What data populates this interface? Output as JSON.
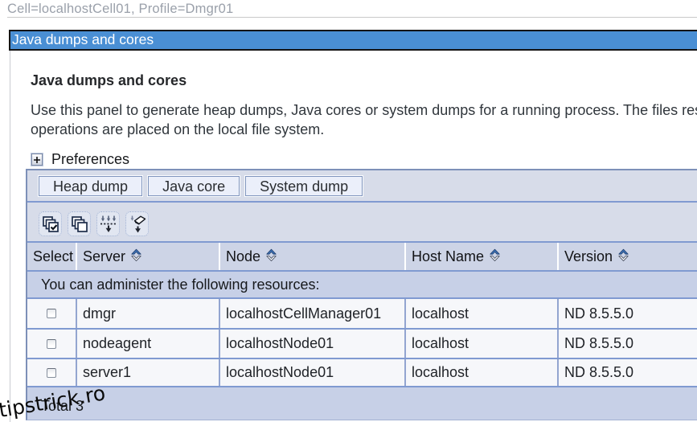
{
  "theme": {
    "title_bar_blue": "#4a8fd4",
    "toolbar_bg": "#d7dce9",
    "header_bg": "#cdd4e6",
    "band_bg": "#c7d0e7",
    "row_bg": "#f6f7fa",
    "grid_blue": "#809ad1",
    "breadcrumb_gray": "#9aa0aa"
  },
  "breadcrumb": {
    "text": "Cell=localhostCell01, Profile=Dmgr01"
  },
  "title_bar": {
    "title": "Java dumps and cores"
  },
  "content": {
    "heading": "Java dumps and cores",
    "description_line1": "Use this panel to generate heap dumps, Java cores or system dumps for a running process. The files res",
    "description_line2": "operations are placed on the local file system.",
    "preferences_label": "Preferences",
    "preferences_icon": "plus-expand-icon"
  },
  "table": {
    "buttons": [
      {
        "label": "Heap dump"
      },
      {
        "label": "Java core"
      },
      {
        "label": "System dump"
      }
    ],
    "icon_buttons": [
      {
        "name": "select-all-items-icon"
      },
      {
        "name": "deselect-all-items-icon"
      },
      {
        "name": "show-filter-function-icon"
      },
      {
        "name": "clear-filter-value-icon"
      }
    ],
    "columns": [
      {
        "label": "Select",
        "sortable": false
      },
      {
        "label": "Server",
        "sortable": true
      },
      {
        "label": "Node",
        "sortable": true
      },
      {
        "label": "Host Name",
        "sortable": true
      },
      {
        "label": "Version",
        "sortable": true
      }
    ],
    "caption": "You can administer the following resources:",
    "rows": [
      {
        "selected": false,
        "server": "dmgr",
        "node": "localhostCellManager01",
        "host_name": "localhost",
        "version": "ND 8.5.5.0"
      },
      {
        "selected": false,
        "server": "nodeagent",
        "node": "localhostNode01",
        "host_name": "localhost",
        "version": "ND 8.5.5.0"
      },
      {
        "selected": false,
        "server": "server1",
        "node": "localhostNode01",
        "host_name": "localhost",
        "version": "ND 8.5.5.0"
      }
    ],
    "total_label": "Total 3"
  },
  "watermark": {
    "text": "tipstrick.ro"
  }
}
